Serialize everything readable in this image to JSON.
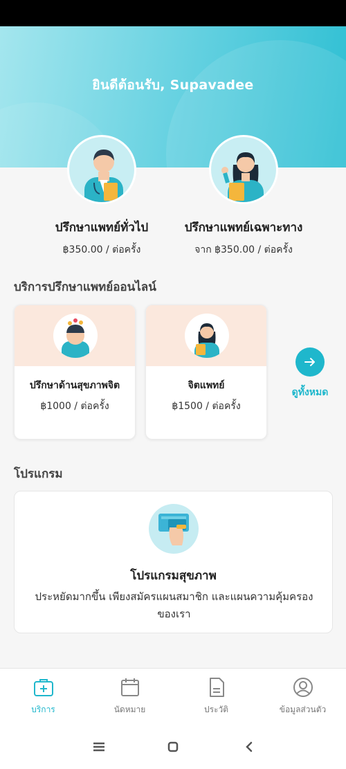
{
  "header": {
    "welcome": "ยินดีต้อนรับ, Supavadee"
  },
  "consults": [
    {
      "title": "ปรึกษาแพทย์ทั่วไป",
      "price": "฿350.00 / ต่อครั้ง"
    },
    {
      "title": "ปรึกษาแพทย์เฉพาะทาง",
      "price": "จาก ฿350.00 / ต่อครั้ง"
    }
  ],
  "online": {
    "section_title": "บริการปรึกษาแพทย์ออนไลน์",
    "cards": [
      {
        "title": "ปรึกษาด้านสุขภาพจิต",
        "price": "฿1000 / ต่อครั้ง"
      },
      {
        "title": "จิตแพทย์",
        "price": "฿1500 / ต่อครั้ง"
      }
    ],
    "see_all": "ดูทั้งหมด"
  },
  "programs": {
    "section_title": "โปรแกรม",
    "card": {
      "title": "โปรแกรมสุขภาพ",
      "description": "ประหยัดมากขึ้น เพียงสมัครแผนสมาชิก และแผนความคุ้มครองของเรา"
    }
  },
  "bottom_nav": [
    {
      "label": "บริการ",
      "icon": "medical-bag-icon",
      "active": true
    },
    {
      "label": "นัดหมาย",
      "icon": "calendar-icon",
      "active": false
    },
    {
      "label": "ประวัติ",
      "icon": "document-icon",
      "active": false
    },
    {
      "label": "ข้อมูลส่วนตัว",
      "icon": "user-circle-icon",
      "active": false
    }
  ],
  "colors": {
    "accent": "#1fb7cc",
    "hero_start": "#a4e6ee",
    "hero_end": "#2ebfd3",
    "card_top": "#fbe8dd"
  }
}
